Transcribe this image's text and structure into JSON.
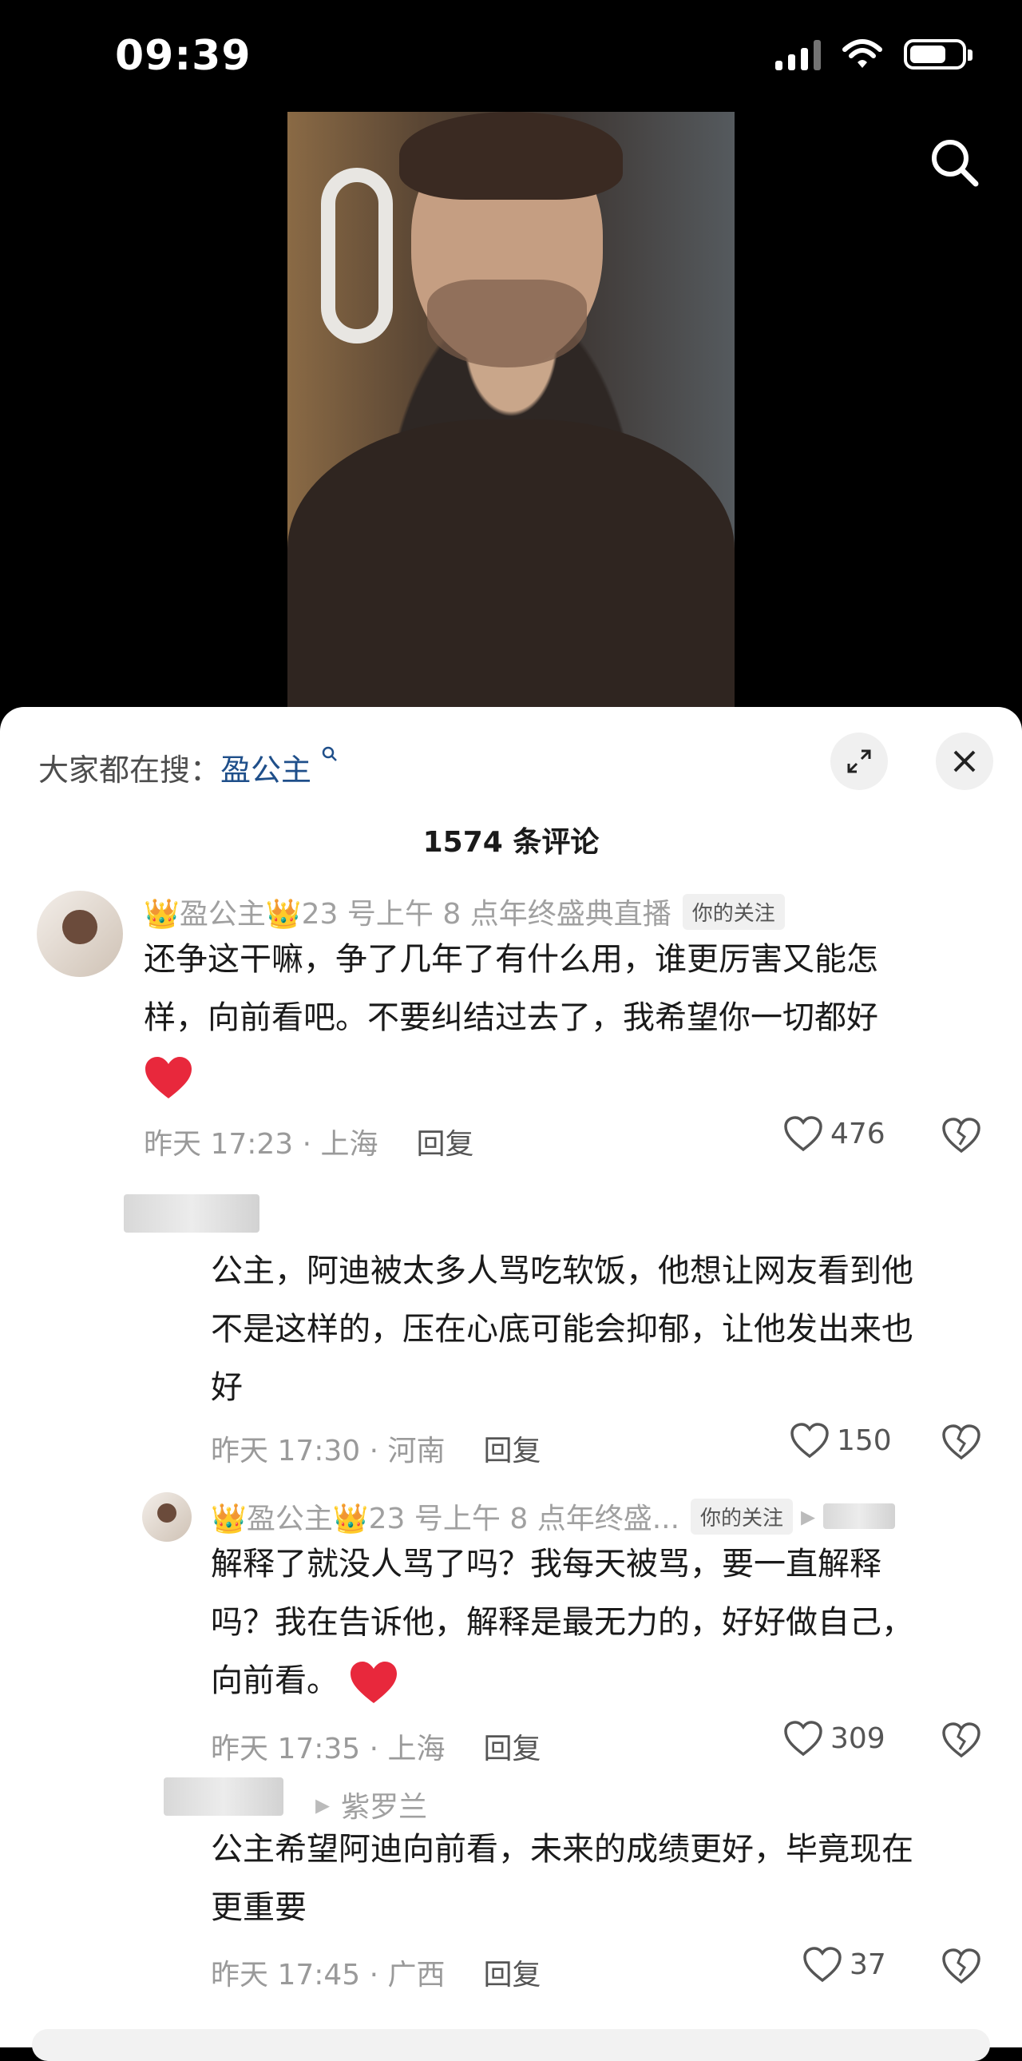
{
  "status_bar": {
    "time": "09:39"
  },
  "panel": {
    "search_prefix": "大家都在搜：",
    "search_keyword": "盈公主",
    "comment_count": "1574 条评论"
  },
  "comments": [
    {
      "user_prefix": "👑盈公主👑",
      "user_desc": "23 号上午 8 点年终盛典直播",
      "badge": "你的关注",
      "text_line1": "还争这干嘛，争了几年了有什么用，谁更厉害又能怎",
      "text_line2": "样，向前看吧。不要纠结过去了，我希望你一切都好",
      "time_loc": "昨天 17:23 · 上海",
      "reply": "回复",
      "likes": "476"
    },
    {
      "text_line1": "公主，阿迪被太多人骂吃软饭，他想让网友看到他",
      "text_line2": "不是这样的，压在心底可能会抑郁，让他发出来也",
      "text_line3": "好",
      "time_loc": "昨天 17:30 · 河南",
      "reply": "回复",
      "likes": "150"
    },
    {
      "user_prefix": "👑盈公主👑",
      "user_desc": "23 号上午 8 点年终盛...",
      "badge": "你的关注",
      "text_line1": "解释了就没人骂了吗？我每天被骂，要一直解释",
      "text_line2": "吗？我在告诉他，解释是最无力的，好好做自己，",
      "text_line3": "向前看。",
      "time_loc": "昨天 17:35 · 上海",
      "reply": "回复",
      "likes": "309"
    },
    {
      "reply_to": "紫罗兰",
      "text_line1": "公主希望阿迪向前看，未来的成绩更好，毕竟现在",
      "text_line2": "更重要",
      "time_loc": "昨天 17:45 · 广西",
      "reply": "回复",
      "likes": "37"
    }
  ]
}
